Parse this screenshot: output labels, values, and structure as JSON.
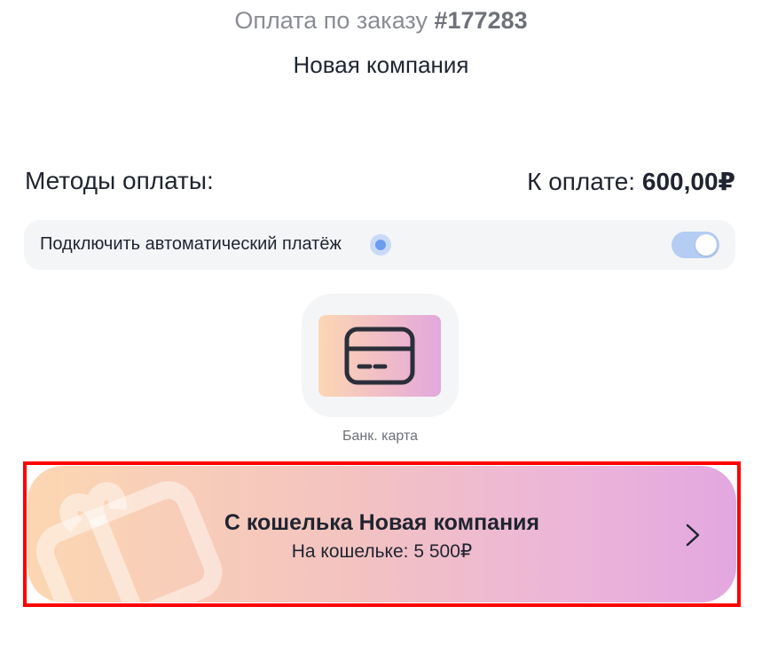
{
  "order": {
    "label": "Оплата по заказу",
    "number": "#177283"
  },
  "company": {
    "name": "Новая компания"
  },
  "payment": {
    "methods_label": "Методы оплаты:",
    "to_pay_label": "К оплате:",
    "to_pay_amount": "600,00₽"
  },
  "autopay": {
    "label": "Подключить автоматический платёж",
    "enabled": true
  },
  "methods": [
    {
      "label": "Банк. карта",
      "icon": "credit-card-icon"
    }
  ],
  "wallet": {
    "title": "С кошелька Новая компания",
    "balance_label": "На кошельке:",
    "balance_amount": "5 500₽",
    "icon": "gift-card-icon"
  },
  "colors": {
    "text": "#1f2430",
    "muted": "#8a8d93",
    "panel": "#f4f5f7",
    "toggle_on": "#b5cdf3",
    "info_dot": "#6b9cf0",
    "gradient_start": "#fcd7b2",
    "gradient_end": "#e3a7e0",
    "highlight": "#ff0000"
  }
}
